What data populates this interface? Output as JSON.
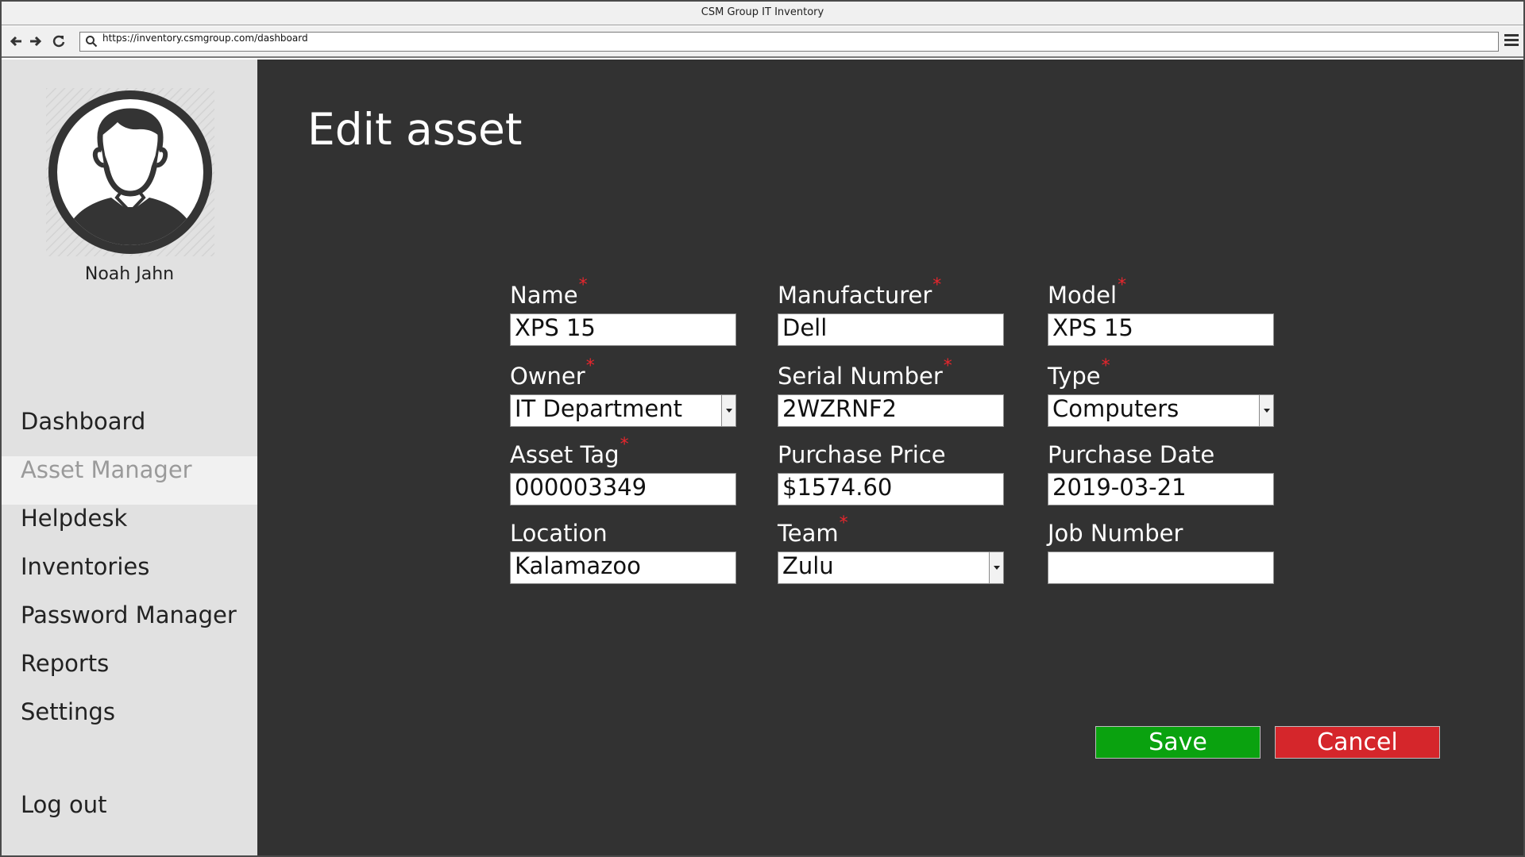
{
  "window": {
    "title": "CSM Group IT Inventory",
    "url": "https://inventory.csmgroup.com/dashboard"
  },
  "toolbar": {
    "back_icon": "arrow-left-icon",
    "forward_icon": "arrow-right-icon",
    "reload_icon": "reload-icon",
    "search_icon": "search-icon",
    "menu_icon": "hamburger-menu-icon"
  },
  "sidebar": {
    "user_name": "Noah Jahn",
    "avatar_icon": "user-avatar-icon",
    "items": [
      {
        "label": "Dashboard",
        "active": false
      },
      {
        "label": "Asset Manager",
        "active": true
      },
      {
        "label": "Helpdesk",
        "active": false
      },
      {
        "label": "Inventories",
        "active": false
      },
      {
        "label": "Password Manager",
        "active": false
      },
      {
        "label": "Reports",
        "active": false
      },
      {
        "label": "Settings",
        "active": false
      }
    ],
    "logout_label": "Log out"
  },
  "page": {
    "title": "Edit asset"
  },
  "form": {
    "required_marker": "*",
    "name": {
      "label": "Name",
      "value": "XPS 15",
      "required": true
    },
    "manufacturer": {
      "label": "Manufacturer",
      "value": "Dell",
      "required": true
    },
    "model": {
      "label": "Model",
      "value": "XPS 15",
      "required": true
    },
    "owner": {
      "label": "Owner",
      "value": "IT Department",
      "required": true
    },
    "serial_number": {
      "label": "Serial Number",
      "value": "2WZRNF2",
      "required": true
    },
    "type": {
      "label": "Type",
      "value": "Computers",
      "required": true
    },
    "asset_tag": {
      "label": "Asset Tag",
      "value": "000003349",
      "required": true
    },
    "purchase_price": {
      "label": "Purchase Price",
      "value": "$1574.60",
      "required": false
    },
    "purchase_date": {
      "label": "Purchase Date",
      "value": "2019-03-21",
      "required": false
    },
    "location": {
      "label": "Location",
      "value": "Kalamazoo",
      "required": false
    },
    "team": {
      "label": "Team",
      "value": "Zulu",
      "required": true
    },
    "job_number": {
      "label": "Job Number",
      "value": "",
      "required": false
    }
  },
  "actions": {
    "save_label": "Save",
    "cancel_label": "Cancel"
  },
  "colors": {
    "main_background": "#323232",
    "sidebar_background": "#e1e1e1",
    "active_nav_background": "#f1f1f1",
    "required_marker": "#e8262d",
    "save_button": "#0aa20f",
    "cancel_button": "#d5262b"
  }
}
